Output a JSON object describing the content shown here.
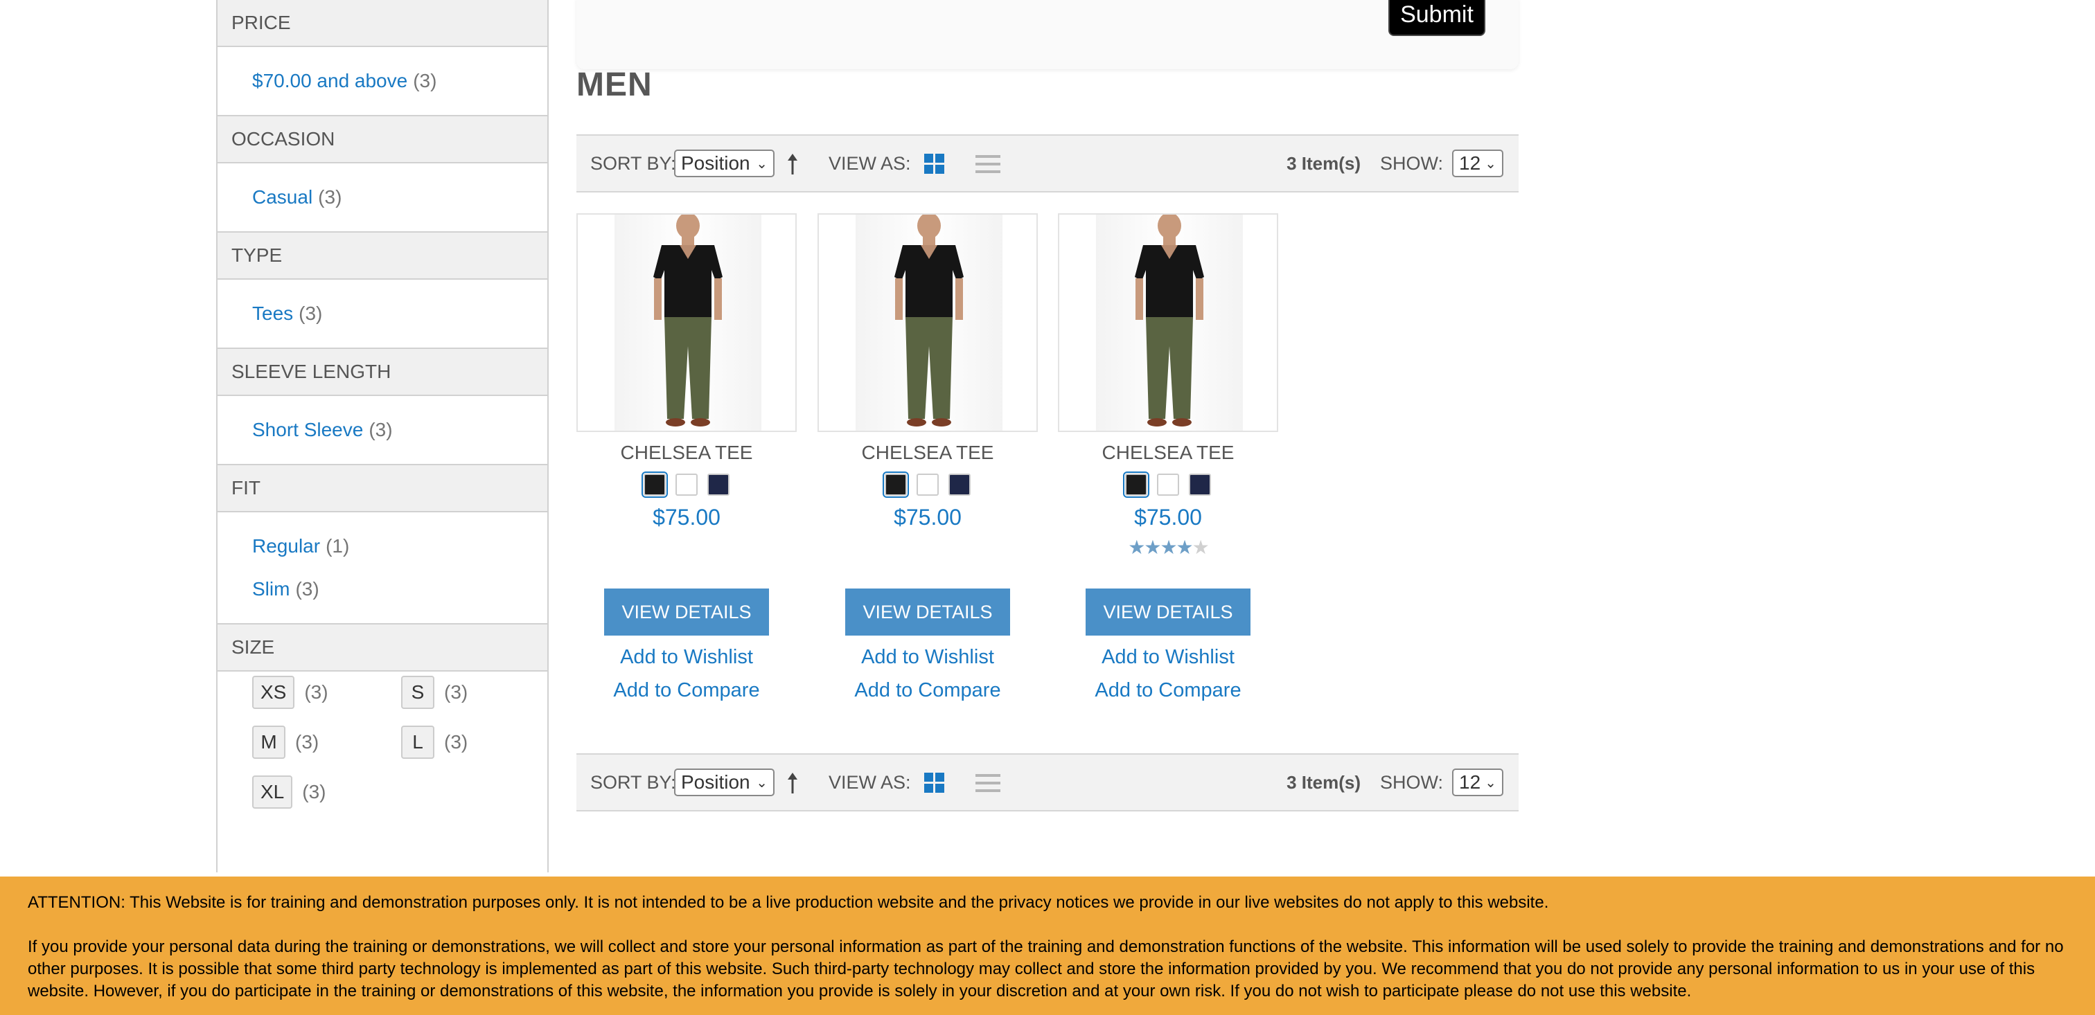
{
  "search": {
    "submit_label": "Submit"
  },
  "page_title": "MEN",
  "filters": {
    "price": {
      "title": "PRICE",
      "items": [
        {
          "label": "$70.00 and above",
          "count": "(3)"
        }
      ]
    },
    "occasion": {
      "title": "OCCASION",
      "items": [
        {
          "label": "Casual",
          "count": "(3)"
        }
      ]
    },
    "type": {
      "title": "TYPE",
      "items": [
        {
          "label": "Tees",
          "count": "(3)"
        }
      ]
    },
    "sleeve": {
      "title": "SLEEVE LENGTH",
      "items": [
        {
          "label": "Short Sleeve",
          "count": "(3)"
        }
      ]
    },
    "fit": {
      "title": "FIT",
      "items": [
        {
          "label": "Regular",
          "count": "(1)"
        },
        {
          "label": "Slim",
          "count": "(3)"
        }
      ]
    },
    "size": {
      "title": "SIZE",
      "items": [
        {
          "label": "XS",
          "count": "(3)"
        },
        {
          "label": "S",
          "count": "(3)"
        },
        {
          "label": "M",
          "count": "(3)"
        },
        {
          "label": "L",
          "count": "(3)"
        },
        {
          "label": "XL",
          "count": "(3)"
        }
      ]
    }
  },
  "toolbar": {
    "sort_by_label": "SORT BY:",
    "sort_value": "Position",
    "view_as_label": "VIEW AS:",
    "grid_mode_icon": "grid-icon",
    "list_mode_icon": "list-icon",
    "items_count": "3 Item(s)",
    "show_label": "SHOW:",
    "show_value": "12"
  },
  "products": [
    {
      "name": "CHELSEA TEE",
      "price": "$75.00",
      "rating": null,
      "details_label": "VIEW DETAILS",
      "wishlist_label": "Add to Wishlist",
      "compare_label": "Add to Compare"
    },
    {
      "name": "CHELSEA TEE",
      "price": "$75.00",
      "rating": null,
      "details_label": "VIEW DETAILS",
      "wishlist_label": "Add to Wishlist",
      "compare_label": "Add to Compare"
    },
    {
      "name": "CHELSEA TEE",
      "price": "$75.00",
      "rating": 4,
      "details_label": "VIEW DETAILS",
      "wishlist_label": "Add to Wishlist",
      "compare_label": "Add to Compare"
    }
  ],
  "swatch_colors": [
    "#1b1b1b",
    "#ffffff",
    "#1f2748"
  ],
  "colors": {
    "accent": "#1979c3",
    "button": "#4a90c8",
    "notice_bg": "#f0a93c"
  },
  "notice": {
    "line1": "ATTENTION: This Website is for training and demonstration purposes only. It is not intended to be a live production website and the privacy notices we provide in our live websites do not apply to this website.",
    "line2": "If you provide your personal data during the training or demonstrations, we will collect and store your personal information as part of the training and demonstration functions of the website. This information will be used solely to provide the training and demonstrations and for no other purposes. It is possible that some third party technology is implemented as part of this website. Such third-party technology may collect and store the information provided by you. We recommend that you do not provide any personal information to us in your use of this website. However, if you do participate in the training or demonstrations of this website, the information you provide is solely in your discretion and at your own risk. If you do not wish to participate please do not use this website."
  }
}
